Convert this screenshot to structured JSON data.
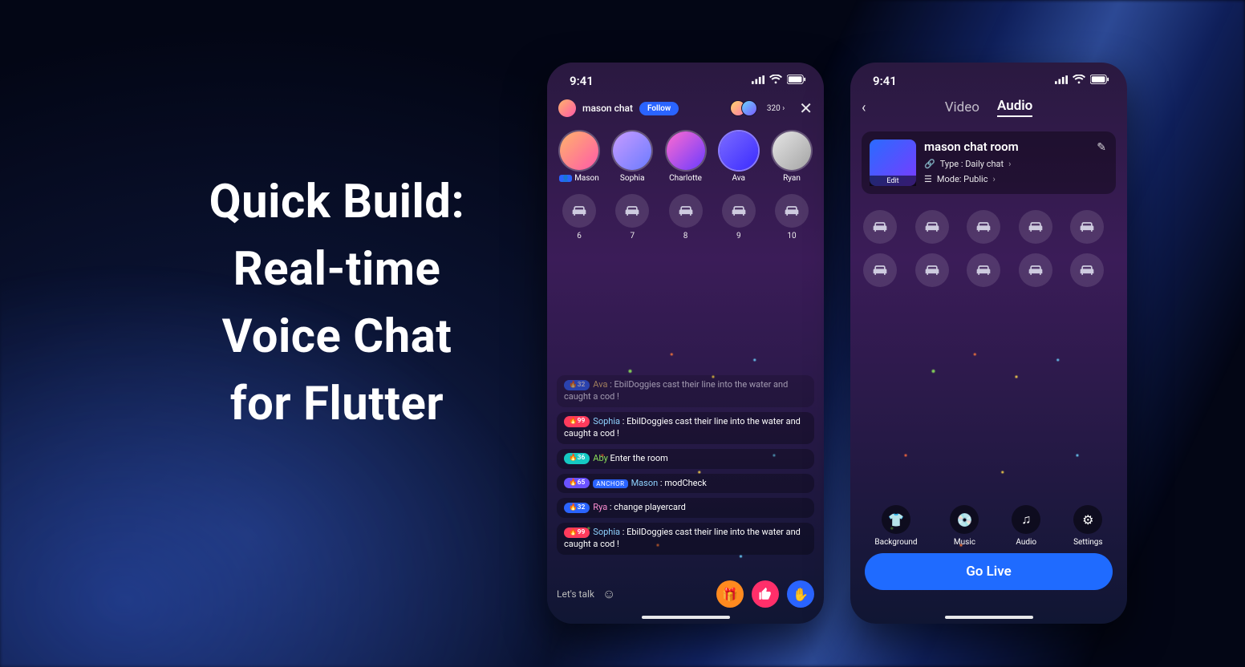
{
  "headline": "Quick Build:\nReal-time\nVoice Chat\nfor Flutter",
  "status": {
    "time": "9:41"
  },
  "phoneA": {
    "room_name": "mason chat",
    "follow": "Follow",
    "viewer_count": "320 ›",
    "seats_top": [
      {
        "name": "Mason",
        "host": true
      },
      {
        "name": "Sophia"
      },
      {
        "name": "Charlotte"
      },
      {
        "name": "Ava"
      },
      {
        "name": "Ryan"
      }
    ],
    "seats_empty": [
      "6",
      "7",
      "8",
      "9",
      "10"
    ],
    "messages": [
      {
        "badge": "32",
        "badgeClass": "bblue",
        "nick": "Ava",
        "nickClass": "gold",
        "text": " : EbilDoggies cast their line into the water and caught a cod !",
        "faded": true
      },
      {
        "badge": "99",
        "badgeClass": "bred",
        "nick": "Sophia",
        "nickClass": "",
        "text": " : EbilDoggies cast their line into the water and caught a cod !"
      },
      {
        "badge": "36",
        "badgeClass": "bteal",
        "nick": "Aby",
        "nickClass": "green",
        "text": " Enter the room"
      },
      {
        "badge": "65",
        "badgeClass": "bpurp",
        "anchor": "ANCHOR",
        "nick": "Mason",
        "nickClass": "",
        "text": " : modCheck"
      },
      {
        "badge": "32",
        "badgeClass": "bblue",
        "nick": "Rya",
        "nickClass": "pink",
        "text": " : change playercard"
      },
      {
        "badge": "99",
        "badgeClass": "bred",
        "nick": "Sophia",
        "nickClass": "",
        "text": " : EbilDoggies cast their line into the water and caught a cod !"
      }
    ],
    "input_placeholder": "Let's talk"
  },
  "phoneB": {
    "tabs": {
      "video": "Video",
      "audio": "Audio"
    },
    "card": {
      "title": "mason chat room",
      "edit": "Edit",
      "type_label": "Type : Daily chat",
      "mode_label": "Mode: Public"
    },
    "tools": [
      {
        "label": "Background",
        "icon": "👕"
      },
      {
        "label": "Music",
        "icon": "💿"
      },
      {
        "label": "Audio",
        "icon": "♫"
      },
      {
        "label": "Settings",
        "icon": "⚙"
      }
    ],
    "golive": "Go Live",
    "seat_count": 10
  }
}
